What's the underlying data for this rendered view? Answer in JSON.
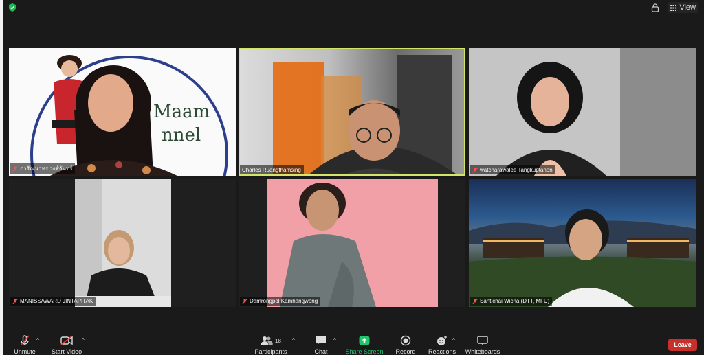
{
  "topbar": {
    "view_label": "View"
  },
  "participants_tiles": [
    {
      "name": "ภารัณนาทร วงศ์จันทร์",
      "muted": true
    },
    {
      "name": "Charles Ruangthamsing",
      "muted": false,
      "active_speaker": true
    },
    {
      "name": "watcharawalee Tangkuptanon",
      "muted": true
    },
    {
      "name": "MANISSAWARD JINTAPITAK",
      "muted": true
    },
    {
      "name": "Damrongpol Kamhangwong",
      "muted": true
    },
    {
      "name": "Santichai Wicha (DTT, MFU)",
      "muted": true
    }
  ],
  "tile1_logo": {
    "line1": "Maam",
    "line2": "nnel"
  },
  "toolbar": {
    "unmute": "Unmute",
    "start_video": "Start Video",
    "participants": "Participants",
    "participants_count": "18",
    "chat": "Chat",
    "share_screen": "Share Screen",
    "record": "Record",
    "reactions": "Reactions",
    "whiteboards": "Whiteboards",
    "leave": "Leave"
  },
  "colors": {
    "accent_green": "#21c46b",
    "leave_red": "#c9302c",
    "active_border": "#d5e46a"
  }
}
